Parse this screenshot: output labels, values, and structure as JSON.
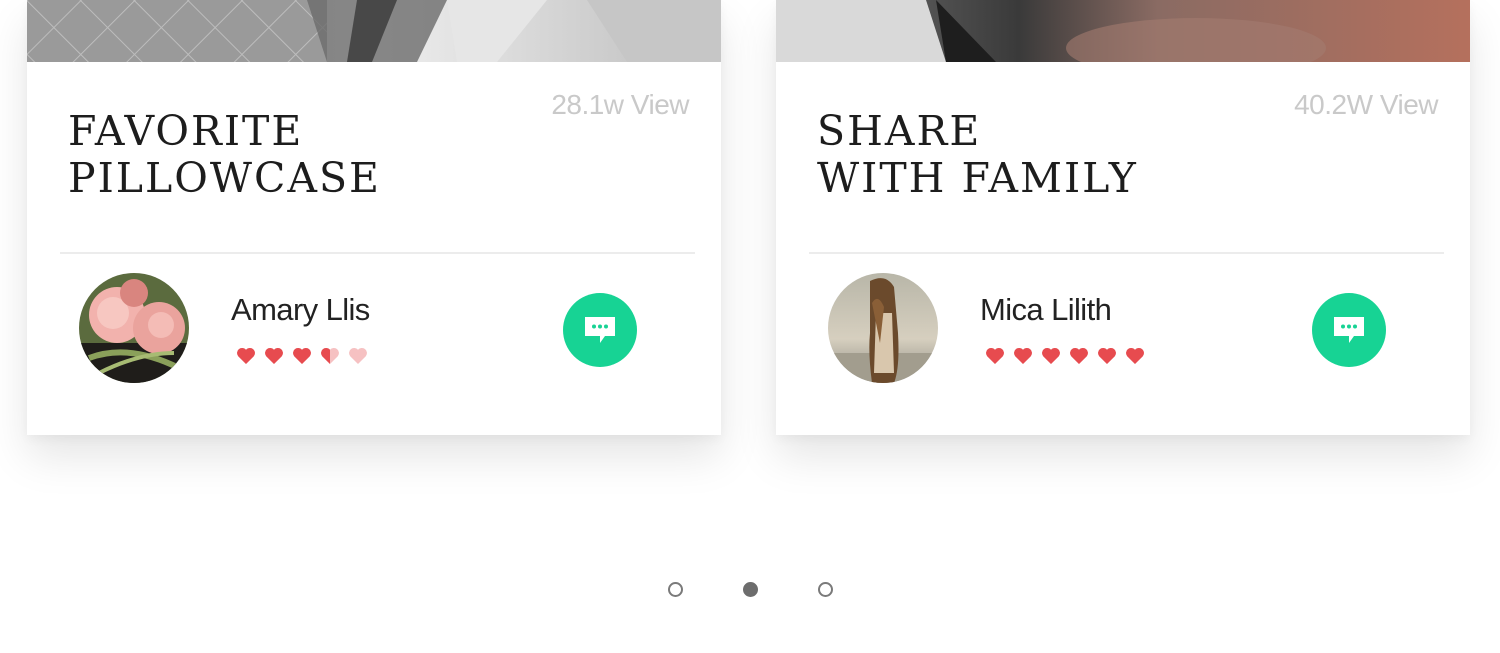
{
  "cards": [
    {
      "title_line1": "FAVORITE",
      "title_line2": "PILLOWCASE",
      "views": "28.1w View",
      "author": "Amary Llis",
      "rating": 3.5,
      "rating_max": 5,
      "cover_image": "quilted-pillow-photo",
      "avatar_image": "pink-roses-photo",
      "chat_icon": "chat-bubble-icon"
    },
    {
      "title_line1": "SHARE",
      "title_line2": "WITH FAMILY",
      "views": "40.2W View",
      "author": "Mica Lilith",
      "rating": 6,
      "rating_max": 6,
      "cover_image": "portrait-photo",
      "avatar_image": "woman-beach-photo",
      "chat_icon": "chat-bubble-icon"
    }
  ],
  "pagination": {
    "pages": 3,
    "active_index": 1
  },
  "colors": {
    "accent": "#17d394",
    "heart": "#e74b4f",
    "heart_empty": "#f6c1c2",
    "muted_text": "#c9c9c9",
    "title_text": "#1d1d1d"
  }
}
